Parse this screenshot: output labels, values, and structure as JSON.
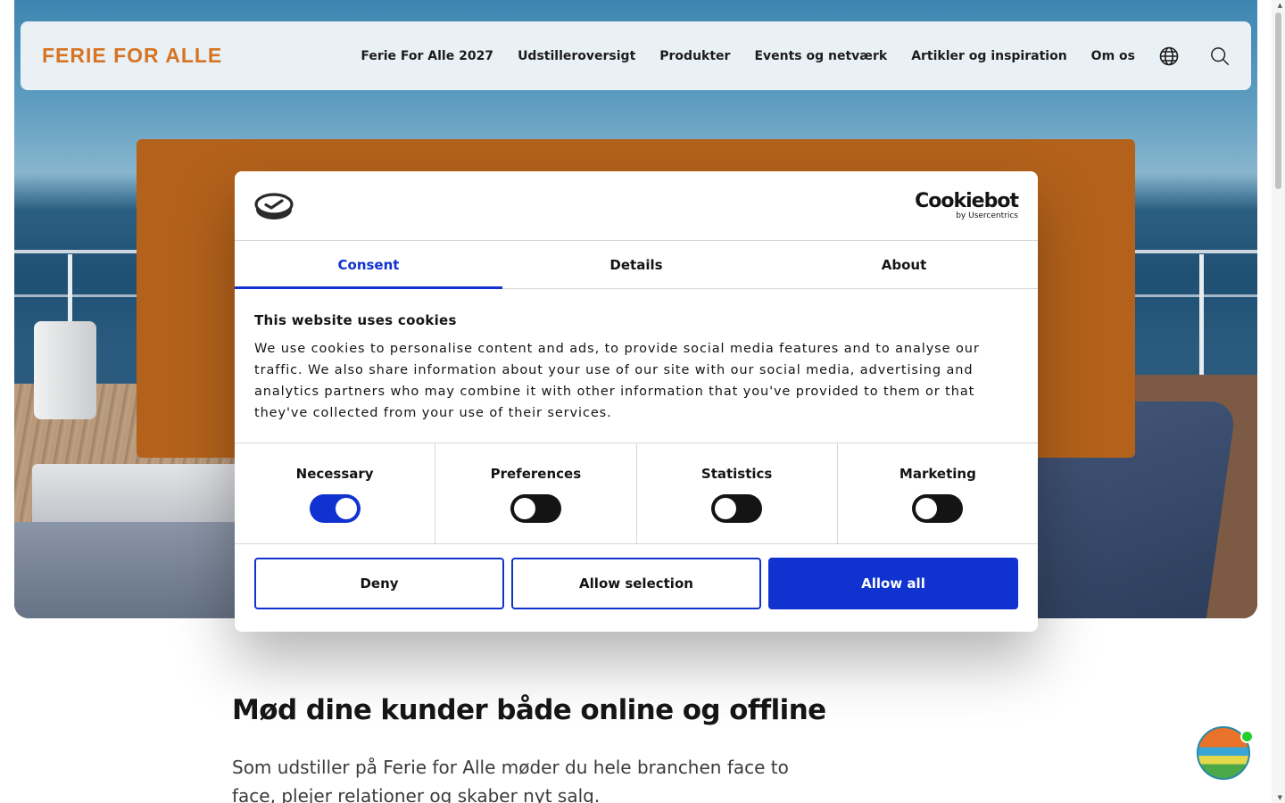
{
  "header": {
    "logo": "FERIE FOR ALLE",
    "nav": [
      {
        "label": "Ferie For Alle 2027"
      },
      {
        "label": "Udstilleroversigt"
      },
      {
        "label": "Produkter"
      },
      {
        "label": "Events og netværk"
      },
      {
        "label": "Artikler og inspiration"
      },
      {
        "label": "Om os"
      }
    ],
    "icons": [
      "globe-icon",
      "search-icon"
    ]
  },
  "cookie_dialog": {
    "brand": {
      "name": "Cookiebot",
      "sub": "by Usercentrics"
    },
    "tabs": [
      {
        "label": "Consent",
        "active": true
      },
      {
        "label": "Details",
        "active": false
      },
      {
        "label": "About",
        "active": false
      }
    ],
    "title": "This website uses cookies",
    "text": "We use cookies to personalise content and ads, to provide social media features and to analyse our traffic. We also share information about your use of our site with our social media, advertising and analytics partners who may combine it with other information that you've provided to them or that they've collected from your use of their services.",
    "toggles": [
      {
        "label": "Necessary",
        "on": true
      },
      {
        "label": "Preferences",
        "on": false
      },
      {
        "label": "Statistics",
        "on": false
      },
      {
        "label": "Marketing",
        "on": false
      }
    ],
    "buttons": {
      "deny": "Deny",
      "allow_selection": "Allow selection",
      "allow_all": "Allow all"
    },
    "colors": {
      "accent": "#1032cf"
    }
  },
  "content": {
    "heading": "Mød dine kunder både online og offline",
    "text": "Som udstiller på Ferie for Alle møder du hele branchen face to face, plejer relationer og skaber nyt salg."
  },
  "colors": {
    "brand_orange": "#d77423",
    "banner_orange": "#b4621b"
  }
}
